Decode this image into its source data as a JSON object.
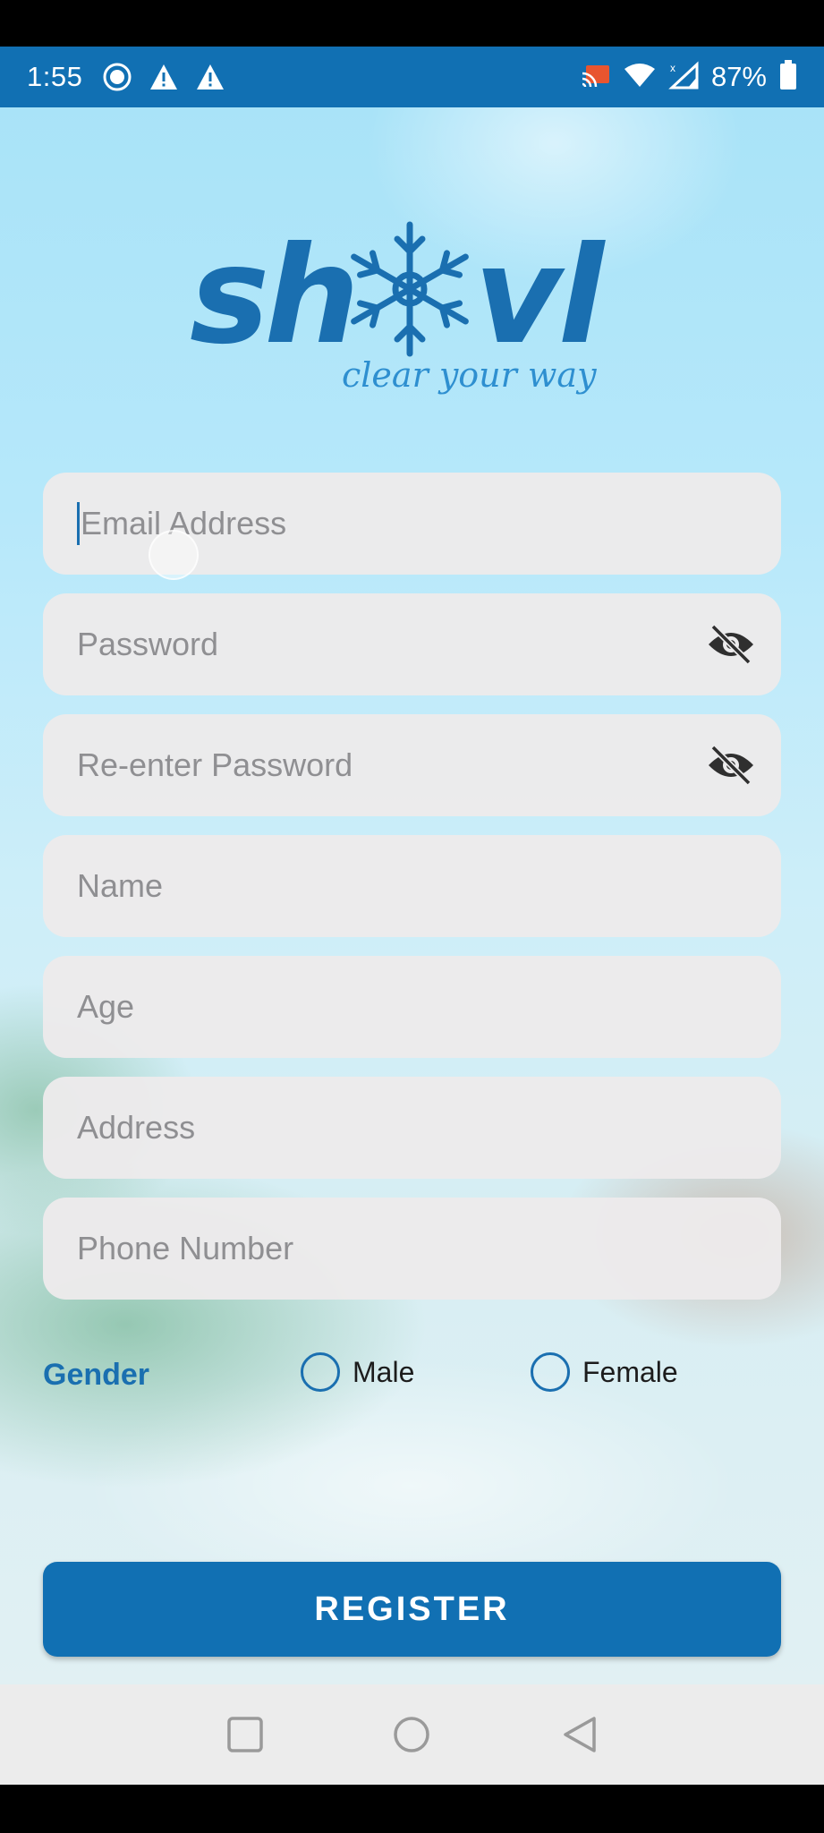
{
  "status_bar": {
    "time": "1:55",
    "battery": "87%",
    "icons": [
      "record-icon",
      "warning-icon",
      "warning-icon",
      "cast-icon",
      "wifi-icon",
      "signal-icon",
      "battery-icon"
    ]
  },
  "logo": {
    "brand": "shovl",
    "tagline": "clear your way",
    "color": "#1a6fb0"
  },
  "form": {
    "email_placeholder": "Email Address",
    "password_placeholder": "Password",
    "reenter_password_placeholder": "Re-enter Password",
    "name_placeholder": "Name",
    "age_placeholder": "Age",
    "address_placeholder": "Address",
    "phone_placeholder": "Phone Number",
    "password_toggle_icon": "eye-off-icon"
  },
  "gender": {
    "label": "Gender",
    "options": [
      "Male",
      "Female"
    ],
    "selected": null
  },
  "register_label": "REGISTER",
  "nav_bar": {
    "buttons": [
      "recent-apps-icon",
      "home-icon",
      "back-icon"
    ]
  },
  "colors": {
    "accent": "#1170b3",
    "field_bg": "#eceaeb",
    "placeholder": "#8f8f92"
  }
}
